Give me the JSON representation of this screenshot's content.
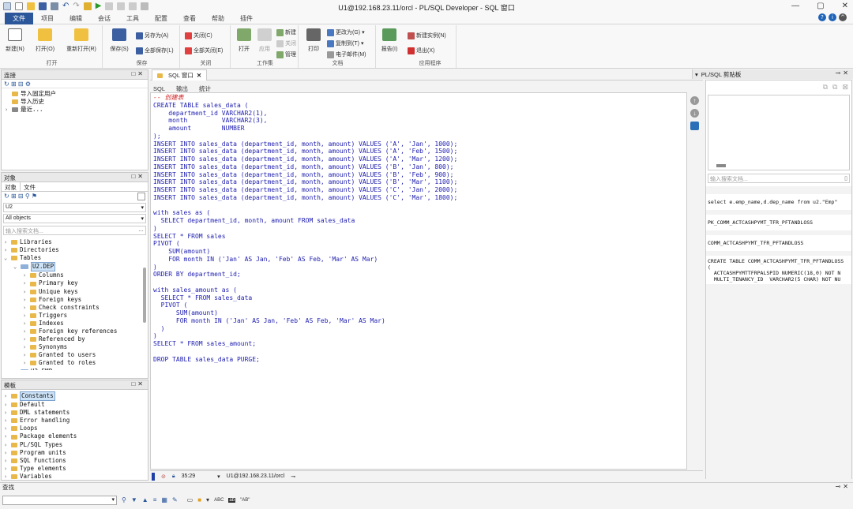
{
  "window": {
    "title": "U1@192.168.23.11/orcl - PL/SQL Developer - SQL 窗口",
    "min": "—",
    "max": "▢",
    "close": "✕"
  },
  "menu": [
    "文件",
    "项目",
    "编辑",
    "会话",
    "工具",
    "配置",
    "查看",
    "帮助",
    "插件"
  ],
  "ribbon": {
    "groups": [
      "打开",
      "保存",
      "关闭",
      "工作集",
      "文档",
      "应用程序"
    ],
    "new": "新建(N)",
    "open": "打开(O)",
    "reopen": "重新打开(R)",
    "save": "保存(S)",
    "saveas": "另存为(A)",
    "saveall": "全部保存(L)",
    "close": "关闭(C)",
    "closeall": "全部关闭(E)",
    "ws_open": "打开",
    "ws_apply": "应用",
    "ws_new": "新建",
    "ws_close": "关闭",
    "ws_manage": "管理",
    "print": "打印",
    "copyto": "复制到(T)",
    "changeto": "更改为(G)",
    "email": "电子邮件(M)",
    "report": "报告(I)",
    "newinstance": "新建实例(N)",
    "exit": "退出(X)"
  },
  "connections": {
    "title": "连接",
    "items": [
      "导入固定用户",
      "导入历史",
      "最近..."
    ]
  },
  "objects": {
    "title": "对象",
    "tabs": [
      "对象",
      "文件"
    ],
    "user": "U2",
    "filter": "All objects",
    "search_placeholder": "输入搜索文档...",
    "tree": [
      {
        "label": "Libraries",
        "level": 0
      },
      {
        "label": "Directories",
        "level": 0
      },
      {
        "label": "Tables",
        "level": 0,
        "open": true
      },
      {
        "label": "U2.DEP",
        "level": 1,
        "selected": true,
        "open": true
      },
      {
        "label": "Columns",
        "level": 2
      },
      {
        "label": "Primary key",
        "level": 2
      },
      {
        "label": "Unique keys",
        "level": 2
      },
      {
        "label": "Foreign keys",
        "level": 2
      },
      {
        "label": "Check constraints",
        "level": 2
      },
      {
        "label": "Triggers",
        "level": 2
      },
      {
        "label": "Indexes",
        "level": 2
      },
      {
        "label": "Foreign key references",
        "level": 2
      },
      {
        "label": "Referenced by",
        "level": 2
      },
      {
        "label": "Synonyms",
        "level": 2
      },
      {
        "label": "Granted to users",
        "level": 2
      },
      {
        "label": "Granted to roles",
        "level": 2
      },
      {
        "label": "U2.EMP",
        "level": 1
      }
    ]
  },
  "templates": {
    "title": "模板",
    "items": [
      "Constants",
      "Default",
      "DML statements",
      "Error handling",
      "Loops",
      "Package elements",
      "PL/SQL Types",
      "Program units",
      "SQL Functions",
      "Type elements",
      "Variables"
    ]
  },
  "editor": {
    "tab": "SQL 窗口",
    "subtabs": [
      "SQL",
      "输出",
      "统计"
    ],
    "lines": [
      "-- 创建表",
      "CREATE TABLE sales_data (",
      "    department_id VARCHAR2(1),",
      "    month         VARCHAR2(3),",
      "    amount        NUMBER",
      ");",
      "INSERT INTO sales_data (department_id, month, amount) VALUES ('A', 'Jan', 1000);",
      "INSERT INTO sales_data (department_id, month, amount) VALUES ('A', 'Feb', 1500);",
      "INSERT INTO sales_data (department_id, month, amount) VALUES ('A', 'Mar', 1200);",
      "INSERT INTO sales_data (department_id, month, amount) VALUES ('B', 'Jan', 800);",
      "INSERT INTO sales_data (department_id, month, amount) VALUES ('B', 'Feb', 900);",
      "INSERT INTO sales_data (department_id, month, amount) VALUES ('B', 'Mar', 1100);",
      "INSERT INTO sales_data (department_id, month, amount) VALUES ('C', 'Jan', 2000);",
      "INSERT INTO sales_data (department_id, month, amount) VALUES ('C', 'Mar', 1800);",
      "",
      "with sales as (",
      "  SELECT department_id, month, amount FROM sales_data",
      ")",
      "SELECT * FROM sales",
      "PIVOT (",
      "    SUM(amount)",
      "    FOR month IN ('Jan' AS Jan, 'Feb' AS Feb, 'Mar' AS Mar)",
      ")",
      "ORDER BY department_id;",
      "",
      "with sales_amount as (",
      "  SELECT * FROM sales_data",
      "  PIVOT (",
      "      SUM(amount)",
      "      FOR month IN ('Jan' AS Jan, 'Feb' AS Feb, 'Mar' AS Mar)",
      "  )",
      ")",
      "SELECT * FROM sales_amount;",
      "",
      "DROP TABLE sales_data PURGE;"
    ],
    "status": {
      "position": "35:29",
      "connection": "U1@192.168.23.11/orcl"
    }
  },
  "clipboard": {
    "title": "PL/SQL 剪贴板",
    "search_placeholder": "输入搜索文档...",
    "items": [
      "select e.emp_name,d.dep_name from u2.\"Emp\"",
      "PK_COMM_ACTCASHPYMT_TFR_PFTANDLOSS",
      "COMM_ACTCASHPYMT_TFR_PFTANDLOSS",
      "CREATE TABLE COMM_ACTCASHPYMT_TFR_PFTANDLOSS\n(\n  ACTCASHPYMTTFRPALSPID NUMERIC(18,0) NOT N\n  MULTI_TENANCY_ID  VARCHAR2(5 CHAR) NOT NU"
    ]
  },
  "find": {
    "title": "查找",
    "abc": "ABC",
    "ab": "\"AB\""
  },
  "colors": {
    "accent": "#2b579a",
    "code": "#1d1db0",
    "comment": "#d02020",
    "selection": "#cde3f7"
  }
}
